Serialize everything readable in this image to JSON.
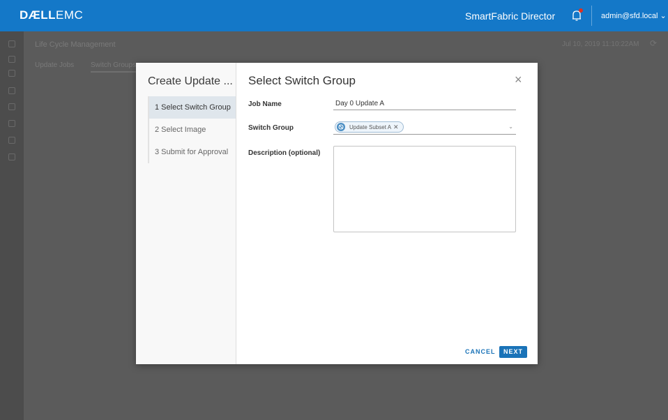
{
  "header": {
    "logo_bold": "DÆLL",
    "logo_light": "EMC",
    "app_title": "SmartFabric Director",
    "user": "admin@sfd.local ⌄"
  },
  "background": {
    "page_title": "Life Cycle Management",
    "timestamp": "Jul 10, 2019 11:10:22AM",
    "tabs": [
      "Update Jobs",
      "Switch Groups"
    ]
  },
  "modal": {
    "wizard_title": "Create Update ...",
    "steps": [
      {
        "label": "1  Select Switch Group",
        "active": true
      },
      {
        "label": "2  Select Image",
        "active": false
      },
      {
        "label": "3  Submit for Approval",
        "active": false
      }
    ],
    "title": "Select Switch Group",
    "close": "×",
    "fields": {
      "job_name_label": "Job Name",
      "job_name_value": "Day 0 Update A",
      "switch_group_label": "Switch Group",
      "switch_group_chip": "Update Subset A",
      "description_label": "Description (optional)",
      "description_value": ""
    },
    "buttons": {
      "cancel": "CANCEL",
      "next": "NEXT"
    }
  },
  "colors": {
    "header_bg": "#1478c8",
    "primary": "#1a73b8",
    "overlay": "#5b5b5b",
    "active_step": "#dfe6ec"
  }
}
